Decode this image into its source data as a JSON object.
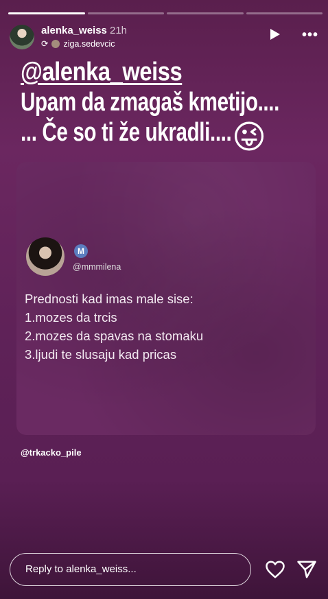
{
  "story": {
    "username": "alenka_weiss",
    "time_ago": "21h",
    "reposted_from": "ziga.sedevcic",
    "progress_segments": 4,
    "active_segment": 1
  },
  "overlay": {
    "mention": "@alenka_weiss",
    "line1": "Upam da zmagaš kmetijo....",
    "line2": "... Če so ti že ukradli....",
    "emoji": "😜"
  },
  "card": {
    "badge_letter": "M",
    "handle": "@mmmilena",
    "lines": [
      "Prednosti kad imas male sise:",
      "1.mozes da trcis",
      "2.mozes da spavas na stomaku",
      "3.ljudi te slusaju kad pricas"
    ]
  },
  "tag": "@trkacko_pile",
  "reply": {
    "placeholder": "Reply to alenka_weiss..."
  }
}
